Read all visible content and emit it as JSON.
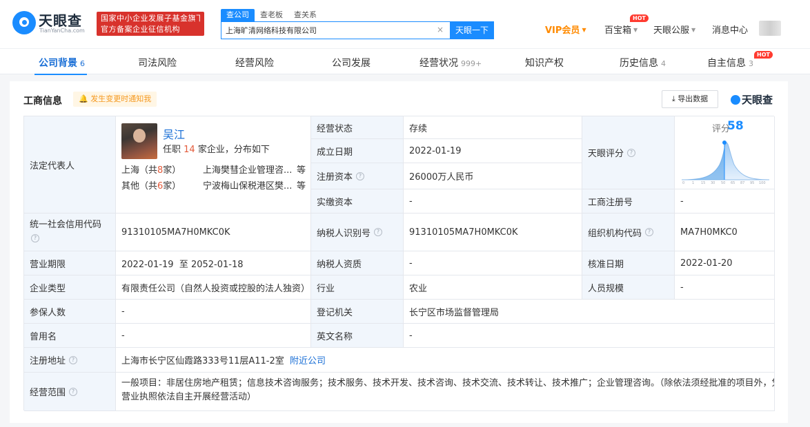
{
  "header": {
    "logo_cn": "天眼查",
    "logo_en": "TianYanCha.com",
    "gov_badge_line1": "国家中小企业发展子基金旗下",
    "gov_badge_line2": "官方备案企业征信机构",
    "search_tabs": [
      "查公司",
      "查老板",
      "查关系"
    ],
    "search_value": "上海旷清网络科技有限公司",
    "search_button": "天眼一下",
    "clear_glyph": "×",
    "nav": {
      "vip": "VIP会员",
      "baibaoxiang": "百宝箱",
      "hot": "HOT",
      "tianyan_gongfu": "天眼公服",
      "messages": "消息中心"
    }
  },
  "tabs": [
    {
      "label": "公司背景",
      "count": "6"
    },
    {
      "label": "司法风险",
      "count": ""
    },
    {
      "label": "经营风险",
      "count": ""
    },
    {
      "label": "公司发展",
      "count": ""
    },
    {
      "label": "经营状况",
      "count": "999+"
    },
    {
      "label": "知识产权",
      "count": ""
    },
    {
      "label": "历史信息",
      "count": "4"
    },
    {
      "label": "自主信息",
      "count": "3"
    }
  ],
  "section": {
    "title": "工商信息",
    "notify": "发生变更时通知我",
    "export": "导出数据",
    "brand": "天眼查"
  },
  "info": {
    "legal_rep_label": "法定代表人",
    "rep_name": "吴江",
    "rep_role_prefix": "任职",
    "rep_role_count": "14",
    "rep_role_suffix": "家企业，分布如下",
    "rep_loc1_prefix": "上海（共",
    "rep_loc1_count": "8",
    "rep_loc1_suffix": "家）",
    "rep_loc1_company": "上海樊彗企业管理咨...",
    "rep_loc2_prefix": "其他（共",
    "rep_loc2_count": "6",
    "rep_loc2_suffix": "家）",
    "rep_loc2_company": "宁波梅山保税港区樊...",
    "etc": "等",
    "status_label": "经营状态",
    "status_value": "存续",
    "founded_label": "成立日期",
    "founded_value": "2022-01-19",
    "reg_capital_label": "注册资本",
    "reg_capital_value": "26000万人民币",
    "paid_capital_label": "实缴资本",
    "paid_capital_value": "-",
    "score_label_cell": "天眼评分",
    "score_label": "评分",
    "score_value": 58,
    "score_axis": [
      "0",
      "1",
      "15",
      "30",
      "50",
      "65",
      "87",
      "95",
      "100"
    ],
    "reg_no_label": "工商注册号",
    "reg_no_value": "-",
    "credit_code_label": "统一社会信用代码",
    "credit_code_value": "91310105MA7H0MKC0K",
    "taxpayer_id_label": "纳税人识别号",
    "taxpayer_id_value": "91310105MA7H0MKC0K",
    "org_code_label": "组织机构代码",
    "org_code_value": "MA7H0MKC0",
    "term_label": "营业期限",
    "term_value": "2022-01-19  至 2052-01-18",
    "taxpayer_qual_label": "纳税人资质",
    "taxpayer_qual_value": "-",
    "approval_label": "核准日期",
    "approval_value": "2022-01-20",
    "type_label": "企业类型",
    "type_value": "有限责任公司（自然人投资或控股的法人独资）",
    "industry_label": "行业",
    "industry_value": "农业",
    "staff_label": "人员规模",
    "staff_value": "-",
    "insured_label": "参保人数",
    "insured_value": "-",
    "authority_label": "登记机关",
    "authority_value": "长宁区市场监督管理局",
    "former_label": "曾用名",
    "former_value": "-",
    "english_label": "英文名称",
    "english_value": "-",
    "address_label": "注册地址",
    "address_value": "上海市长宁区仙霞路333号11层A11-2室",
    "nearby": "附近公司",
    "scope_label": "经营范围",
    "scope_line1": "一般项目：非居住房地产租赁；信息技术咨询服务；技术服务、技术开发、技术咨询、技术交流、技术转让、技术推广；企业管理咨询。（除依法须经批准的项目外，凭",
    "scope_line2": "营业执照依法自主开展经营活动）",
    "help_glyph": "?"
  },
  "colors": {
    "accent": "#1a8cff",
    "link": "#1a6fd6",
    "label_bg": "#f1f6fc",
    "gov_badge": "#d8322c",
    "vip": "#ff8a00",
    "hot": "#ff3b30"
  }
}
